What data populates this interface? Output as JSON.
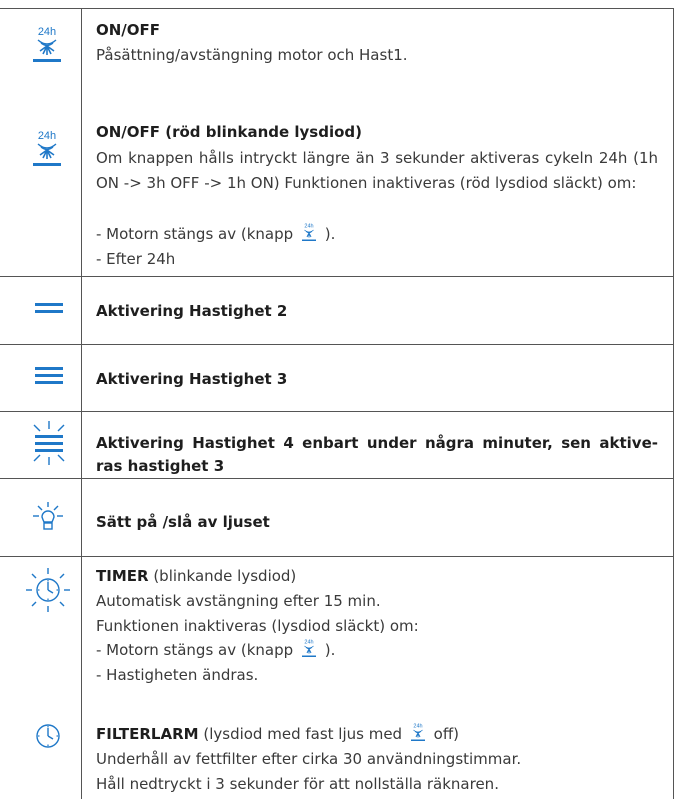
{
  "colors": {
    "icon_blue": "#1f78c8",
    "rule": "#555555",
    "text": "#3a3a3a",
    "title": "#1e1e1e"
  },
  "rows": {
    "onoff": {
      "icon": "24h-fan-icon",
      "icon_label": "24h",
      "title": "ON/OFF",
      "line1": "Påsättning/avstängning motor och Hast1."
    },
    "onoff_red": {
      "icon": "24h-fan-icon",
      "icon_label": "24h",
      "title": "ON/OFF (röd blinkande lysdiod)",
      "paragraph": "Om knappen hålls intryckt längre än 3 sekunder aktiveras cykeln 24h (1h ON -> 3h OFF -> 1h ON) Funktionen inaktiveras (röd lysdiod släckt) om:",
      "bullet1_pre": "- Motorn stängs av (knapp",
      "bullet1_post": ").",
      "bullet2": "- Efter 24h"
    },
    "speed2": {
      "icon": "speed-2-icon",
      "title": "Aktivering Hastighet 2"
    },
    "speed3": {
      "icon": "speed-3-icon",
      "title": "Aktivering Hastighet 3"
    },
    "speed4": {
      "icon": "speed-4-icon",
      "title": "Aktivering Hastighet 4 enbart under några minuter, sen aktive-ras hastighet 3"
    },
    "light": {
      "icon": "light-bulb-icon",
      "title": "Sätt på /slå av ljuset"
    },
    "timer": {
      "icon": "timer-blink-icon",
      "title_bold": "TIMER",
      "title_rest": "(blinkande lysdiod)",
      "line1": "Automatisk avstängning efter 15 min.",
      "line2": "Funktionen inaktiveras (lysdiod släckt) om:",
      "bullet1_pre": "- Motorn stängs av (knapp",
      "bullet1_post": ").",
      "bullet2": "- Hastigheten ändras."
    },
    "filter": {
      "icon": "clock-icon",
      "title_bold": "FILTERLARM",
      "title_rest": "(lysdiod med fast ljus med",
      "title_end": "off)",
      "line1": "Underhåll av fettfilter efter cirka 30 användningstimmar.",
      "line2": "Håll nedtryckt i 3 sekunder för att nollställa räknaren."
    }
  }
}
